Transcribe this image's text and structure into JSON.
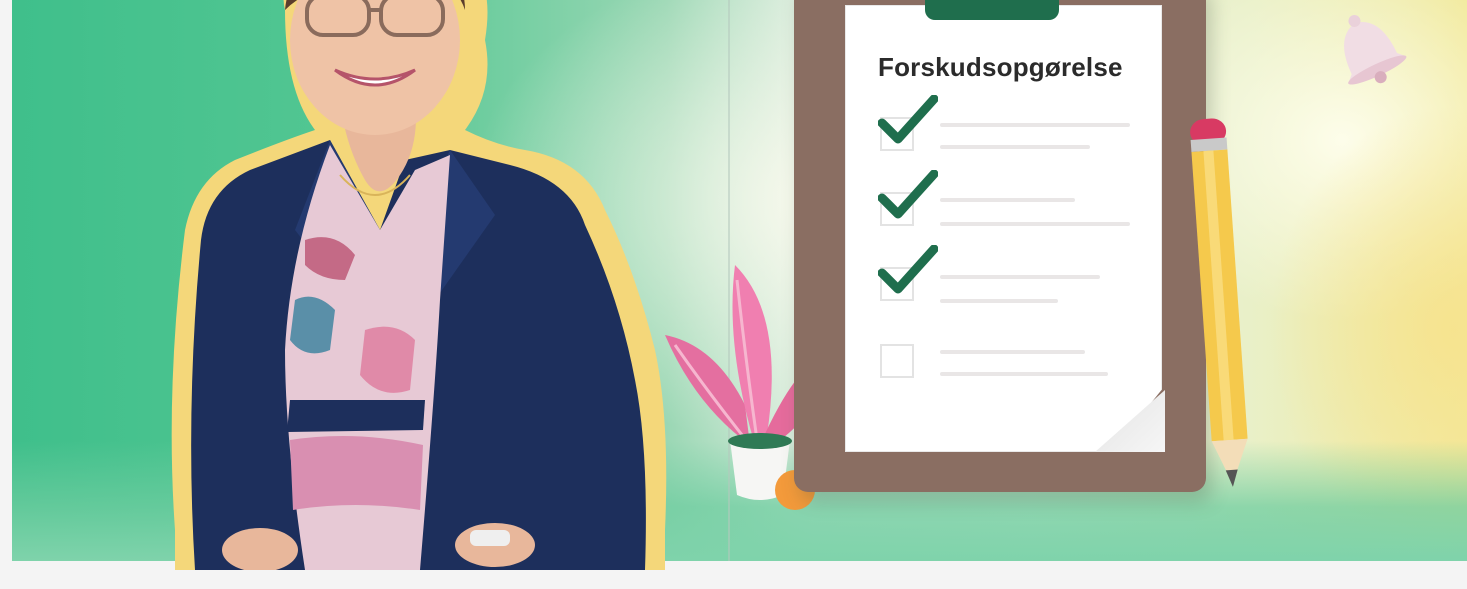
{
  "hero": {
    "sheet_title": "Forskudsopgørelse",
    "checklist": [
      {
        "checked": true
      },
      {
        "checked": true
      },
      {
        "checked": true
      },
      {
        "checked": false
      }
    ]
  },
  "colors": {
    "check_green": "#1f6e4d",
    "jacket_navy": "#1d2f5c",
    "cutout_outline": "#f4d77a"
  },
  "icons": [
    "checkmark-icon",
    "pencil-icon",
    "bell-icon",
    "plant-icon"
  ]
}
